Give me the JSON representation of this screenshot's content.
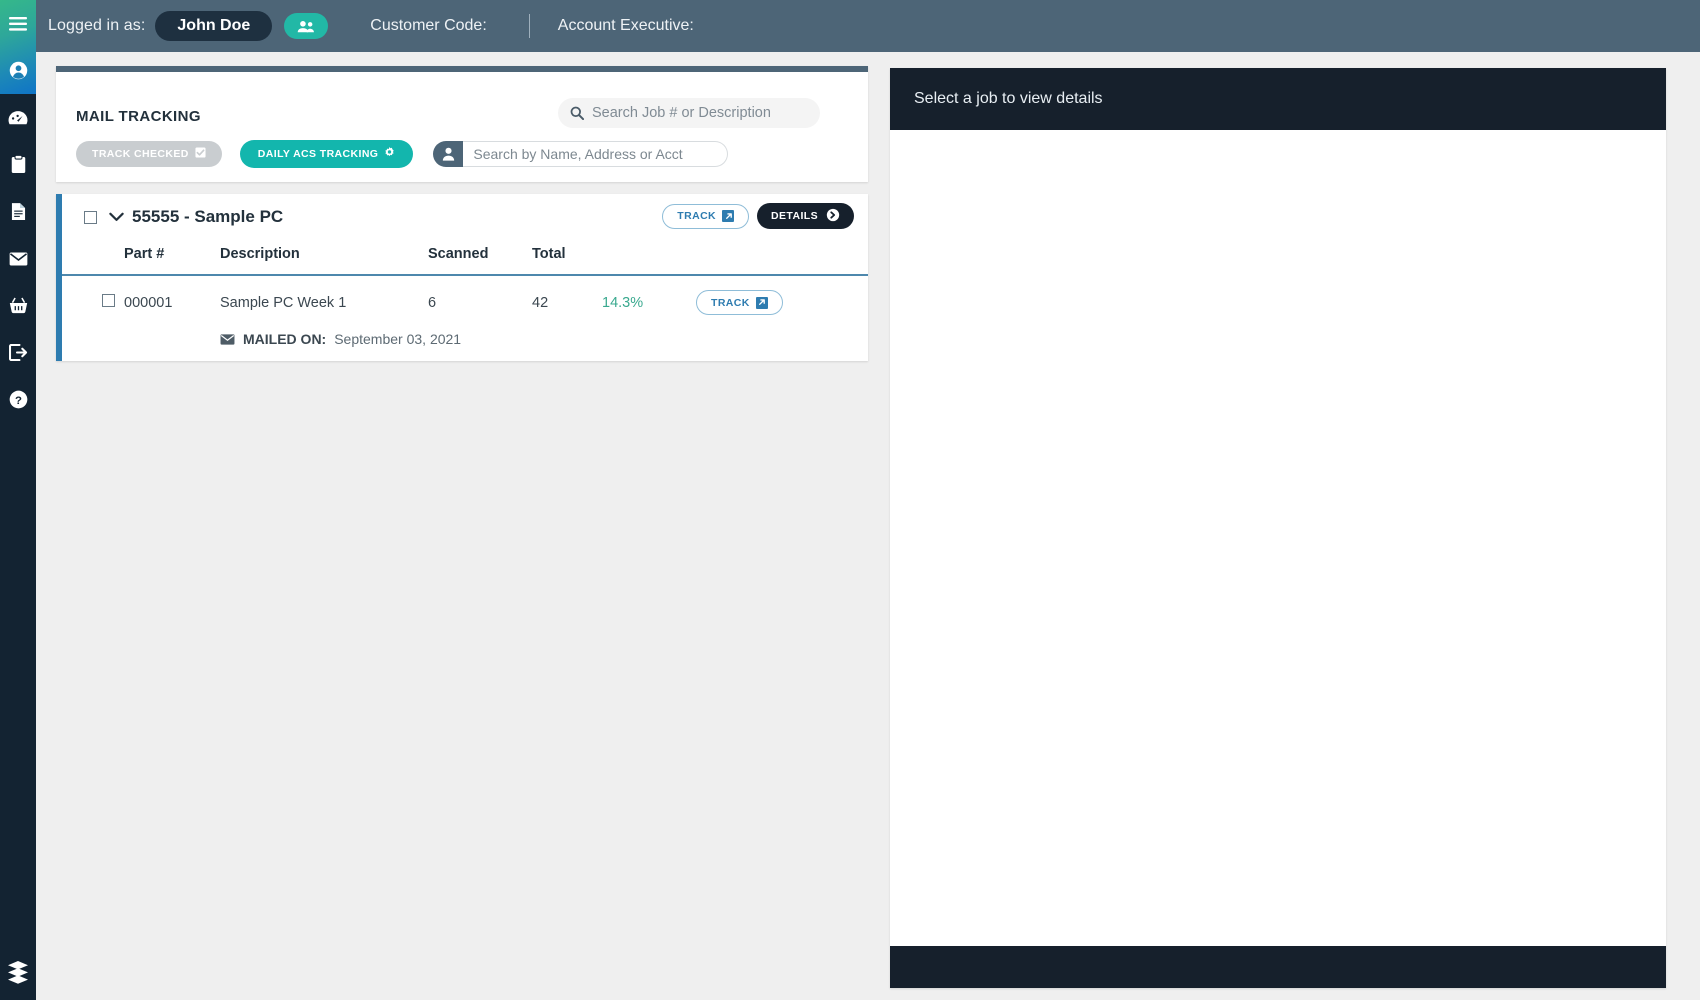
{
  "topbar": {
    "logged_in_label": "Logged in as:",
    "user_name": "John Doe",
    "users_icon": "users-icon",
    "customer_code_label": "Customer Code:",
    "account_executive_label": "Account Executive:"
  },
  "sidebar": {
    "items": [
      {
        "icon": "hamburger-menu-icon",
        "name": "menu-toggle"
      },
      {
        "icon": "user-circle-icon",
        "name": "account"
      },
      {
        "icon": "dashboard-gauge-icon",
        "name": "dashboard"
      },
      {
        "icon": "clipboard-icon",
        "name": "jobs"
      },
      {
        "icon": "document-icon",
        "name": "reports"
      },
      {
        "icon": "envelope-icon",
        "name": "mail-tracking"
      },
      {
        "icon": "basket-icon",
        "name": "orders"
      },
      {
        "icon": "logout-icon",
        "name": "logout"
      },
      {
        "icon": "help-circle-icon",
        "name": "help"
      }
    ],
    "logo": "layers-diamond-logo"
  },
  "panel": {
    "title": "MAIL TRACKING",
    "job_search": {
      "icon": "search-icon",
      "placeholder": "Search Job # or Description",
      "value": ""
    },
    "buttons": {
      "track_checked": "TRACK CHECKED",
      "track_checked_icon": "checkbox-checked-icon",
      "daily_acs_tracking": "DAILY ACS TRACKING",
      "daily_acs_tracking_icon": "gear-icon"
    },
    "name_search": {
      "icon": "person-icon",
      "placeholder": "Search by Name, Address or Acct",
      "value": ""
    }
  },
  "job": {
    "checkbox_checked": false,
    "chevron_icon": "chevron-down-icon",
    "title": "55555 - Sample PC",
    "track_label": "TRACK",
    "track_icon": "external-link-icon",
    "details_label": "DETAILS",
    "details_icon": "arrow-right-circle-icon",
    "columns": [
      "Part #",
      "Description",
      "Scanned",
      "Total"
    ],
    "rows": [
      {
        "checkbox_checked": false,
        "part": "000001",
        "description": "Sample PC Week 1",
        "scanned": "6",
        "total": "42",
        "percent": "14.3%",
        "track_label": "TRACK",
        "track_icon": "external-link-icon",
        "mailed_on_icon": "envelope-icon",
        "mailed_on_label": "MAILED ON:",
        "mailed_on_date": "September 03, 2021"
      }
    ]
  },
  "details_panel": {
    "empty_message": "Select a job to view details"
  },
  "colors": {
    "topbar_bg": "#4d6577",
    "sidebar_bg": "#132332",
    "accent_teal": "#13b6ad",
    "accent_blue": "#2e7cb0",
    "dark_panel": "#16202c",
    "percent_green": "#3aa98f",
    "job_accent_bar": "#2e7cb0"
  }
}
